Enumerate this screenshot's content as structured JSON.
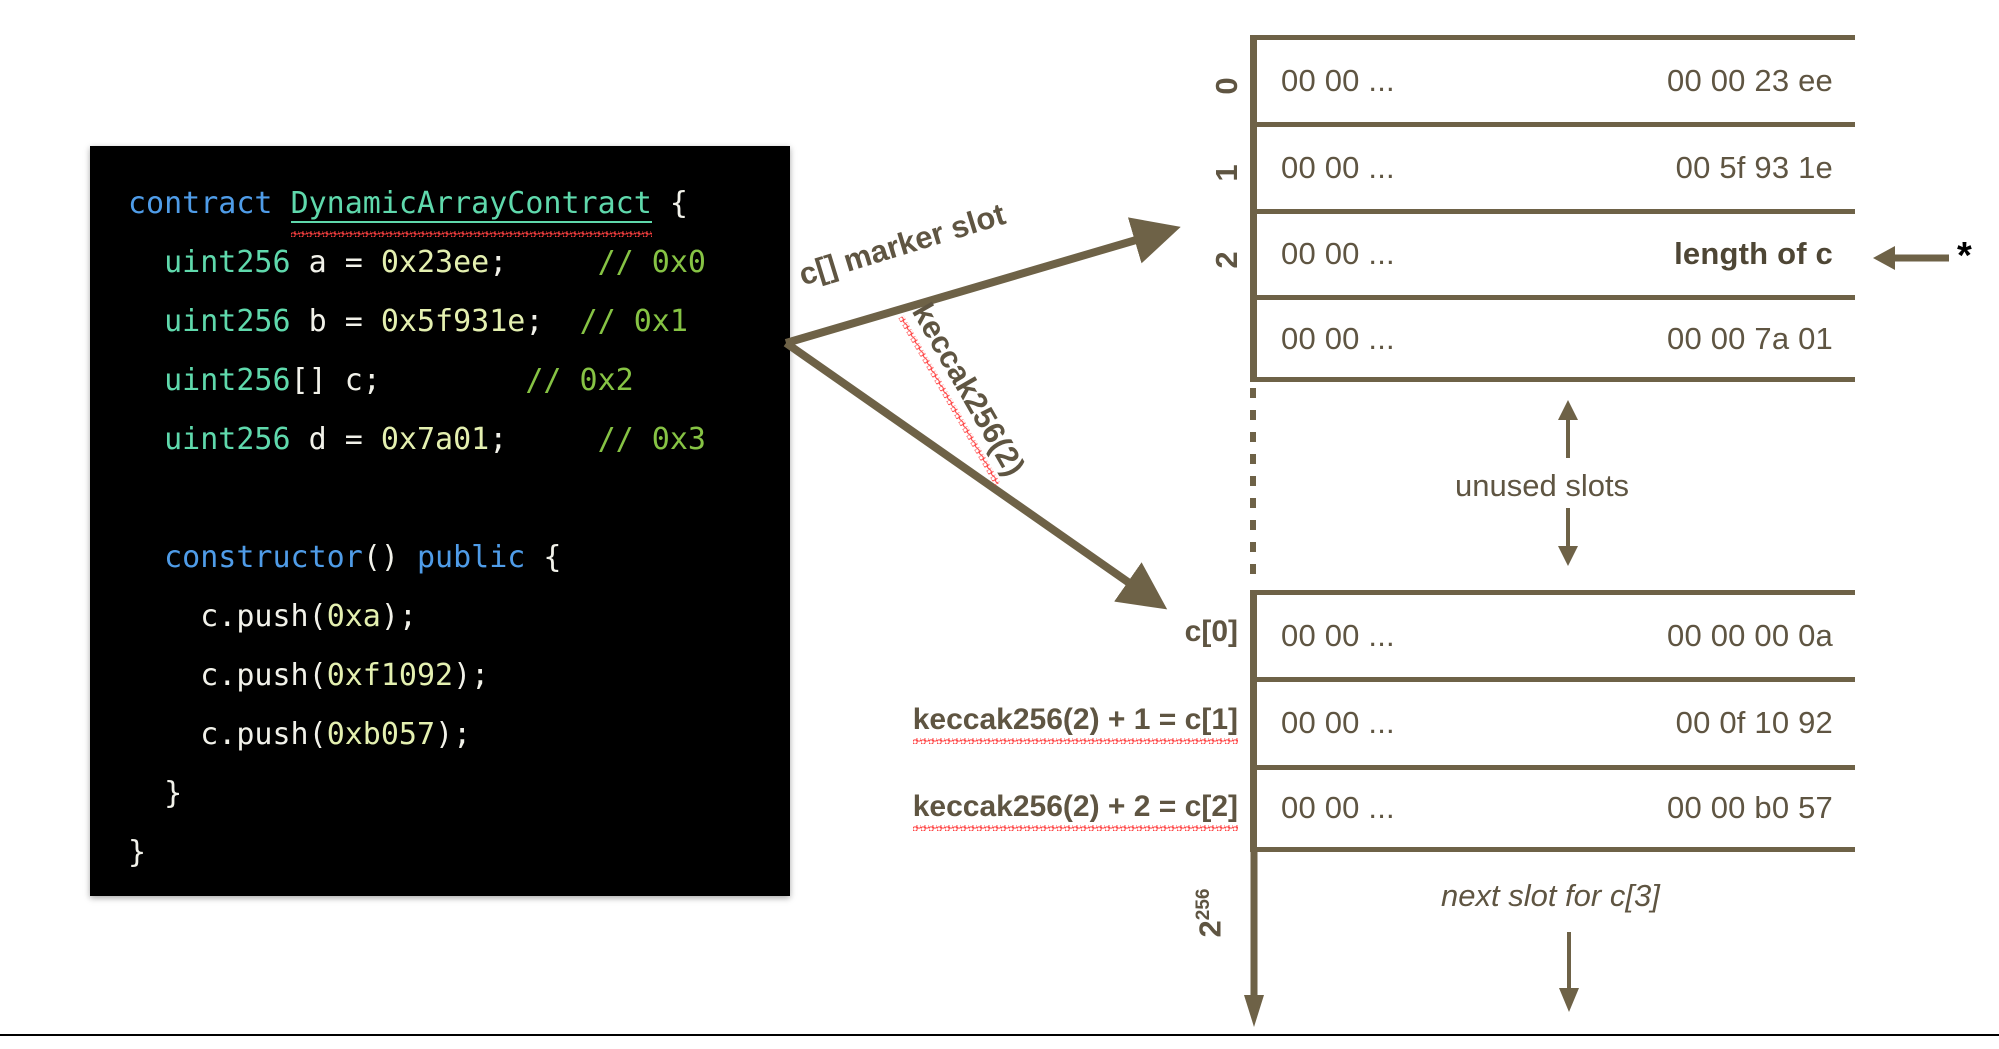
{
  "code": {
    "language": "solidity",
    "lines": [
      {
        "id": "l1",
        "tokens": [
          {
            "t": "contract ",
            "c": "kw"
          },
          {
            "t": "DynamicArrayContract",
            "c": "typename-spell"
          },
          {
            "t": " {",
            "c": "punc"
          }
        ]
      },
      {
        "id": "l2",
        "tokens": [
          {
            "t": "  uint256",
            "c": "type"
          },
          {
            "t": " a = ",
            "c": "ident"
          },
          {
            "t": "0x23ee",
            "c": "num"
          },
          {
            "t": ";     ",
            "c": "punc"
          },
          {
            "t": "// 0x0",
            "c": "comment"
          }
        ]
      },
      {
        "id": "l3",
        "tokens": [
          {
            "t": "  uint256",
            "c": "type"
          },
          {
            "t": " b = ",
            "c": "ident"
          },
          {
            "t": "0x5f931e",
            "c": "num"
          },
          {
            "t": ";  ",
            "c": "punc"
          },
          {
            "t": "// 0x1",
            "c": "comment"
          }
        ]
      },
      {
        "id": "l4",
        "tokens": [
          {
            "t": "  uint256",
            "c": "type"
          },
          {
            "t": "[] c;        ",
            "c": "ident"
          },
          {
            "t": "// 0x2",
            "c": "comment"
          }
        ]
      },
      {
        "id": "l5",
        "tokens": [
          {
            "t": "  uint256",
            "c": "type"
          },
          {
            "t": " d = ",
            "c": "ident"
          },
          {
            "t": "0x7a01",
            "c": "num"
          },
          {
            "t": ";     ",
            "c": "punc"
          },
          {
            "t": "// 0x3",
            "c": "comment"
          }
        ]
      },
      {
        "id": "l6",
        "tokens": [
          {
            "t": " ",
            "c": "punc"
          }
        ]
      },
      {
        "id": "l7",
        "tokens": [
          {
            "t": "  constructor",
            "c": "kw"
          },
          {
            "t": "() ",
            "c": "punc"
          },
          {
            "t": "public",
            "c": "kw"
          },
          {
            "t": " {",
            "c": "punc"
          }
        ]
      },
      {
        "id": "l8",
        "tokens": [
          {
            "t": "    c.push(",
            "c": "ident"
          },
          {
            "t": "0xa",
            "c": "num"
          },
          {
            "t": ");",
            "c": "punc"
          }
        ]
      },
      {
        "id": "l9",
        "tokens": [
          {
            "t": "    c.push(",
            "c": "ident"
          },
          {
            "t": "0xf1092",
            "c": "num"
          },
          {
            "t": ");",
            "c": "punc"
          }
        ]
      },
      {
        "id": "l10",
        "tokens": [
          {
            "t": "    c.push(",
            "c": "ident"
          },
          {
            "t": "0xb057",
            "c": "num"
          },
          {
            "t": ");",
            "c": "punc"
          }
        ]
      },
      {
        "id": "l11",
        "tokens": [
          {
            "t": "  }",
            "c": "punc"
          }
        ]
      },
      {
        "id": "l12",
        "tokens": [
          {
            "t": "}",
            "c": "punc"
          }
        ]
      }
    ]
  },
  "storage_top": {
    "indices": [
      "0",
      "1",
      "2"
    ],
    "rows": [
      {
        "index": "0",
        "prefix": "00 00 ...",
        "value": "00 00 23 ee",
        "bold": false
      },
      {
        "index": "1",
        "prefix": "00 00 ...",
        "value": "00 5f 93 1e",
        "bold": false
      },
      {
        "index": "2",
        "prefix": "00 00 ...",
        "value": "length of c",
        "bold": true
      },
      {
        "index": "",
        "prefix": "00 00 ...",
        "value": "00 00 7a 01",
        "bold": false
      }
    ]
  },
  "storage_bottom": {
    "rows": [
      {
        "label": "c[0]",
        "prefix": "00 00 ...",
        "value": "00 00 00 0a",
        "bold": false
      },
      {
        "label": "keccak256(2) + 1 = c[1]",
        "prefix": "00 00 ...",
        "value": "00 0f 10 92",
        "bold": false
      },
      {
        "label": "keccak256(2) + 2 = c[2]",
        "prefix": "00 00 ...",
        "value": "00 00 b0 57",
        "bold": false
      }
    ]
  },
  "annotations": {
    "arrow_marker_slot": "c[] marker slot",
    "arrow_keccak": "keccak256(2)",
    "unused_slots": "unused slots",
    "next_slot": "next slot for c[3]",
    "axis_base": "2",
    "axis_exponent": "256",
    "asterisk": "*"
  },
  "colors": {
    "diagram_brown": "#6e6247",
    "text_brown": "#5f5542",
    "code_background": "#000000",
    "keyword_blue": "#4f9ce8",
    "type_green": "#5fd9ac",
    "comment_green": "#86c344",
    "number_cream": "#e4f0b0",
    "spellcheck_red": "#ff4040",
    "page_background": "#ffffff"
  }
}
